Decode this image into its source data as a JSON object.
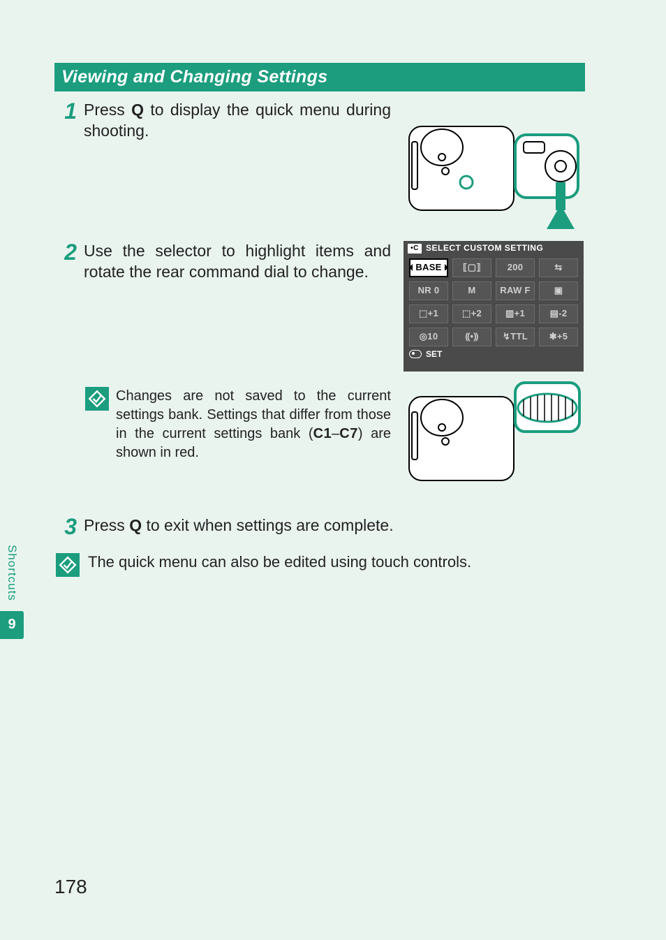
{
  "section_header": "Viewing and Changing Settings",
  "steps": {
    "s1": {
      "num": "1",
      "text_a": "Press ",
      "glyph": "Q",
      "text_b": " to display the quick menu during shooting."
    },
    "s2": {
      "num": "2",
      "text": "Use the selector to highlight items and rotate the rear command dial to change."
    },
    "s3": {
      "num": "3",
      "text_a": "Press ",
      "glyph": "Q",
      "text_b": " to exit when settings are complete."
    }
  },
  "note_step2": {
    "text_a": "Changes are not saved to the current settings bank. Settings that differ from those in the current settings bank (",
    "c1": "C1",
    "dash": "–",
    "c7": "C7",
    "text_b": ") are shown in red."
  },
  "screen": {
    "title": "SELECT CUSTOM SETTING",
    "footer": "SET",
    "cells": [
      "BASE",
      "⟦▢⟧",
      "200",
      "⇆",
      "NR 0",
      "M",
      "RAW F",
      "▣",
      "⬚+1",
      "⬚+2",
      "▥+1",
      "▤-2",
      "◎10",
      "⸨•⸩",
      "↯TTL",
      "✱+5"
    ]
  },
  "footnote": "The quick menu can also be edited using touch controls.",
  "sidebar": {
    "label": "Shortcuts",
    "chapter": "9"
  },
  "page_number": "178"
}
